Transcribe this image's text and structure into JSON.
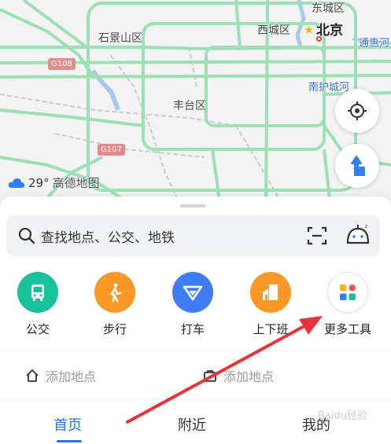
{
  "map": {
    "labels": {
      "dongcheng": "东城区",
      "xicheng": "西城区",
      "beijing": "北京",
      "shijingshan": "石景山区",
      "fengtai": "丰台区",
      "tonghui": "通惠河",
      "nanhu": "南护城河"
    },
    "shields": {
      "g108": "G108",
      "g107": "G107"
    },
    "weather": {
      "temp": "29°",
      "brand": "高德地图",
      "icon": "cloud-icon"
    },
    "colors": {
      "road": "#9ce0b4",
      "river": "#a9c8ee",
      "rail": "#c9cbcf"
    }
  },
  "search": {
    "placeholder": "查找地点、公交、地铁"
  },
  "tools": [
    {
      "label": "公交",
      "color": "#17c29a",
      "icon": "bus-icon"
    },
    {
      "label": "步行",
      "color": "#fb9826",
      "icon": "walk-icon"
    },
    {
      "label": "打车",
      "color": "#3f7cf5",
      "icon": "taxi-icon"
    },
    {
      "label": "上下班",
      "color": "#fb9826",
      "icon": "commute-icon"
    },
    {
      "label": "更多工具",
      "color": "#ffffff",
      "icon": "grid-icon"
    }
  ],
  "quick": {
    "home_label": "添加地点",
    "work_label": "添加地点"
  },
  "nav": {
    "home": "首页",
    "nearby": "附近",
    "mine": "我的"
  },
  "annotation": {
    "arrow_color": "#e8333b"
  },
  "watermark": "Baidu经验"
}
